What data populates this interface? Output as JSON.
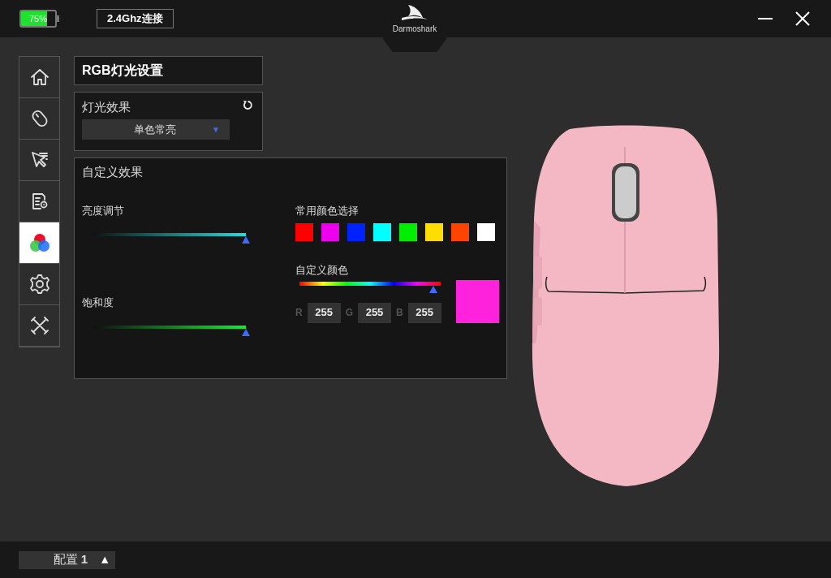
{
  "top_bar": {
    "battery": {
      "text": "75%",
      "level": 0.75
    },
    "connection": "2.4Ghz连接",
    "logo_text": "Darmoshark"
  },
  "sidebar": {
    "items": [
      {
        "kind": "home",
        "selected": false
      },
      {
        "kind": "mouse",
        "selected": false
      },
      {
        "kind": "pointer",
        "selected": false
      },
      {
        "kind": "macro",
        "selected": false
      },
      {
        "kind": "rgb",
        "selected": true
      },
      {
        "kind": "settings",
        "selected": false
      },
      {
        "kind": "tools",
        "selected": false
      }
    ]
  },
  "title": "RGB灯光设置",
  "light_effect": {
    "label": "灯光效果",
    "dropdown": {
      "value": "单色常亮",
      "arrow": "▼"
    }
  },
  "custom_effect": {
    "title": "自定义效果",
    "sliders": [
      {
        "label": "亮度调节",
        "kind": "cyan",
        "level": 1.0
      },
      {
        "label": "饱和度",
        "kind": "green",
        "level": 1.0
      }
    ],
    "preset_label": "常用颜色选择",
    "presets": [
      {
        "color": "#ff0000"
      },
      {
        "color": "#ee00ee"
      },
      {
        "color": "#0022ff"
      },
      {
        "color": "#00ffff"
      },
      {
        "color": "#00ee00"
      },
      {
        "color": "#ffdd00"
      },
      {
        "color": "#ff4400"
      },
      {
        "color": "#ffffff"
      }
    ],
    "custom_label": "自定义颜色",
    "hue": {
      "level": 0.95
    },
    "preview": {
      "color": "#ff22dd"
    },
    "rgb_fields": [
      {
        "label": "R",
        "value": "255"
      },
      {
        "label": "G",
        "value": "255"
      },
      {
        "label": "B",
        "value": "255"
      }
    ]
  },
  "bottom_bar": {
    "profile": {
      "label": "配置",
      "number": "1",
      "arrow": "▲"
    }
  }
}
